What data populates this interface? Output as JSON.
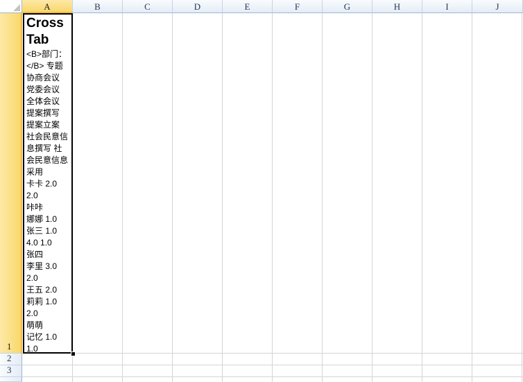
{
  "columns": [
    "A",
    "B",
    "C",
    "D",
    "E",
    "F",
    "G",
    "H",
    "I",
    "J"
  ],
  "rows": [
    "1",
    "2",
    "3"
  ],
  "active_cell": "A1",
  "cell_A1": {
    "title": "Cross\nTab",
    "body": "<B>部门：\n</B> 专题\n协商会议\n党委会议\n全体会议\n提案撰写\n提案立案\n社会民意信\n息撰写 社\n会民意信息\n采用\n卡卡 2.0\n2.0\n咔咔\n娜娜 1.0\n张三 1.0\n4.0 1.0\n张四\n李里 3.0\n2.0\n王五 2.0\n莉莉 1.0\n2.0\n萌萌\n记忆 1.0\n1.0"
  },
  "colors": {
    "active_header": "#f9d86b",
    "gridline": "#d4d4d4",
    "header_border": "#9eb6ce"
  }
}
